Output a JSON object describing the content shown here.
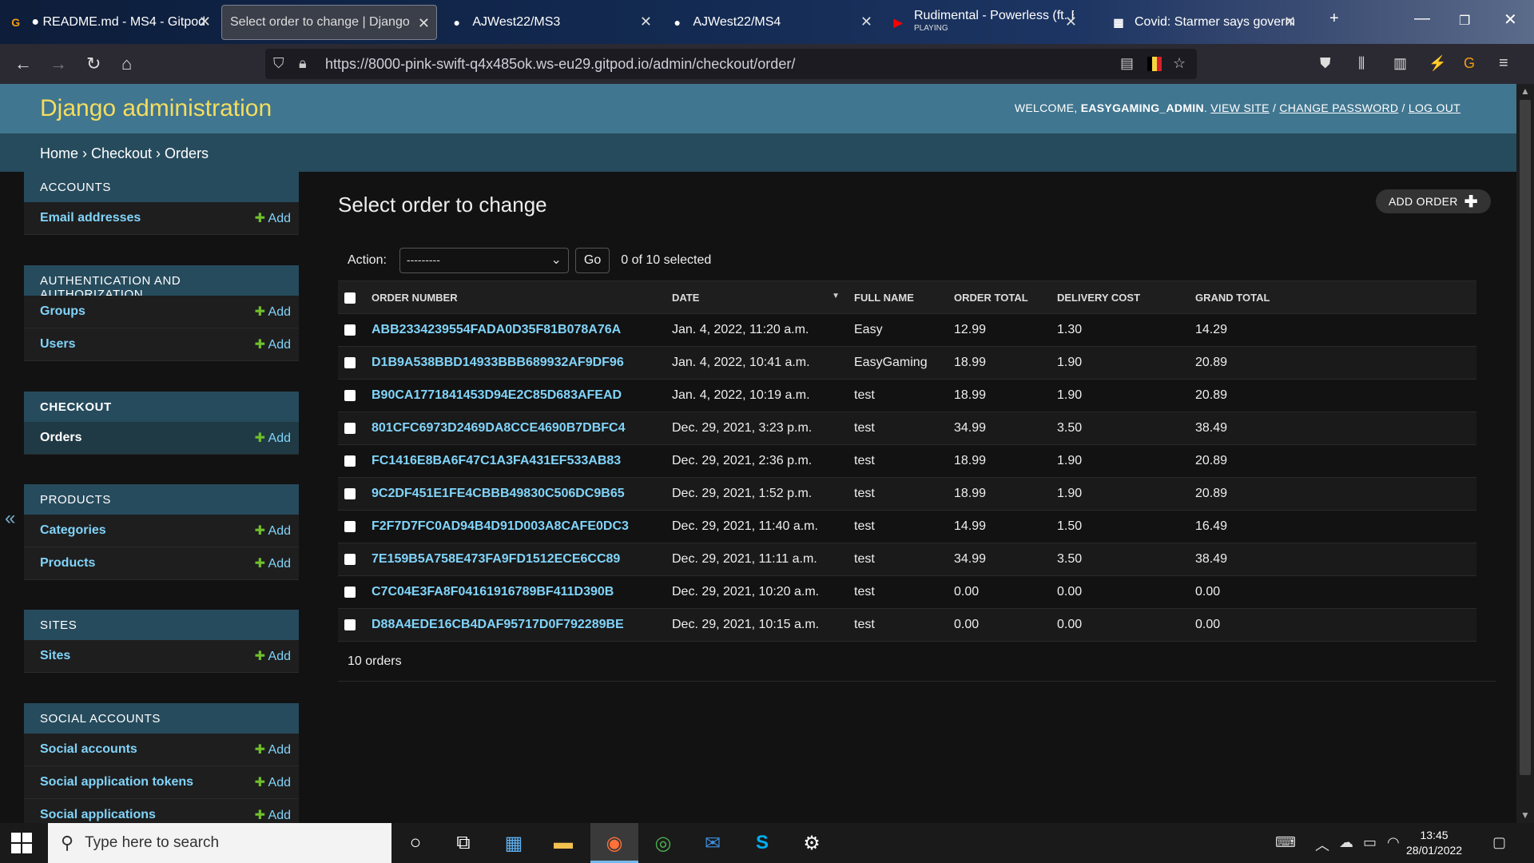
{
  "browser": {
    "tabs": [
      {
        "title": "● README.md - MS4 - Gitpod",
        "sub": ""
      },
      {
        "title": "Select order to change | Django site",
        "sub": ""
      },
      {
        "title": "AJWest22/MS3",
        "sub": ""
      },
      {
        "title": "AJWest22/MS4",
        "sub": ""
      },
      {
        "title": "Rudimental - Powerless (ft. Be",
        "sub": "PLAYING"
      },
      {
        "title": "Covid: Starmer says governme",
        "sub": ""
      }
    ],
    "url": "https://8000-pink-swift-q4x485ok.ws-eu29.gitpod.io/admin/checkout/order/",
    "flag_colors": [
      "#000000",
      "#f5d442",
      "#d6202a"
    ]
  },
  "header": {
    "brand": "Django administration",
    "welcome": "WELCOME,",
    "username": "EASYGAMING_ADMIN",
    "view_site": "VIEW SITE",
    "change_password": "CHANGE PASSWORD",
    "log_out": "LOG OUT"
  },
  "breadcrumbs": "Home › Checkout › Orders",
  "sidebar": {
    "add_label": "Add",
    "modules": [
      {
        "caption": "ACCOUNTS",
        "items": [
          {
            "label": "Email addresses"
          }
        ]
      },
      {
        "caption": "AUTHENTICATION AND AUTHORIZATION",
        "items": [
          {
            "label": "Groups"
          },
          {
            "label": "Users"
          }
        ]
      },
      {
        "caption": "CHECKOUT",
        "items": [
          {
            "label": "Orders"
          }
        ]
      },
      {
        "caption": "PRODUCTS",
        "items": [
          {
            "label": "Categories"
          },
          {
            "label": "Products"
          }
        ]
      },
      {
        "caption": "SITES",
        "items": [
          {
            "label": "Sites"
          }
        ]
      },
      {
        "caption": "SOCIAL ACCOUNTS",
        "items": [
          {
            "label": "Social accounts"
          },
          {
            "label": "Social application tokens"
          },
          {
            "label": "Social applications"
          }
        ]
      }
    ]
  },
  "main": {
    "title": "Select order to change",
    "add_button": "ADD ORDER",
    "action_label": "Action:",
    "action_value": "---------",
    "go": "Go",
    "selected": "0 of 10 selected",
    "columns": [
      "ORDER NUMBER",
      "DATE",
      "FULL NAME",
      "ORDER TOTAL",
      "DELIVERY COST",
      "GRAND TOTAL"
    ],
    "rows": [
      [
        "ABB2334239554FADA0D35F81B078A76A",
        "Jan. 4, 2022, 11:20 a.m.",
        "Easy",
        "12.99",
        "1.30",
        "14.29"
      ],
      [
        "D1B9A538BBD14933BBB689932AF9DF96",
        "Jan. 4, 2022, 10:41 a.m.",
        "EasyGaming",
        "18.99",
        "1.90",
        "20.89"
      ],
      [
        "B90CA1771841453D94E2C85D683AFEAD",
        "Jan. 4, 2022, 10:19 a.m.",
        "test",
        "18.99",
        "1.90",
        "20.89"
      ],
      [
        "801CFC6973D2469DA8CCE4690B7DBFC4",
        "Dec. 29, 2021, 3:23 p.m.",
        "test",
        "34.99",
        "3.50",
        "38.49"
      ],
      [
        "FC1416E8BA6F47C1A3FA431EF533AB83",
        "Dec. 29, 2021, 2:36 p.m.",
        "test",
        "18.99",
        "1.90",
        "20.89"
      ],
      [
        "9C2DF451E1FE4CBBB49830C506DC9B65",
        "Dec. 29, 2021, 1:52 p.m.",
        "test",
        "18.99",
        "1.90",
        "20.89"
      ],
      [
        "F2F7D7FC0AD94B4D91D003A8CAFE0DC3",
        "Dec. 29, 2021, 11:40 a.m.",
        "test",
        "14.99",
        "1.50",
        "16.49"
      ],
      [
        "7E159B5A758E473FA9FD1512ECE6CC89",
        "Dec. 29, 2021, 11:11 a.m.",
        "test",
        "34.99",
        "3.50",
        "38.49"
      ],
      [
        "C7C04E3FA8F04161916789BF411D390B",
        "Dec. 29, 2021, 10:20 a.m.",
        "test",
        "0.00",
        "0.00",
        "0.00"
      ],
      [
        "D88A4EDE16CB4DAF95717D0F792289BE",
        "Dec. 29, 2021, 10:15 a.m.",
        "test",
        "0.00",
        "0.00",
        "0.00"
      ]
    ],
    "paginator": "10 orders"
  },
  "taskbar": {
    "search_placeholder": "Type here to search",
    "time": "13:45",
    "date": "28/01/2022"
  },
  "colors": {
    "header_bg": "#417690",
    "brand": "#f5dd5d",
    "link": "#81d4fa",
    "add_green": "#70bf2b",
    "caption_bg": "#264b5d"
  }
}
